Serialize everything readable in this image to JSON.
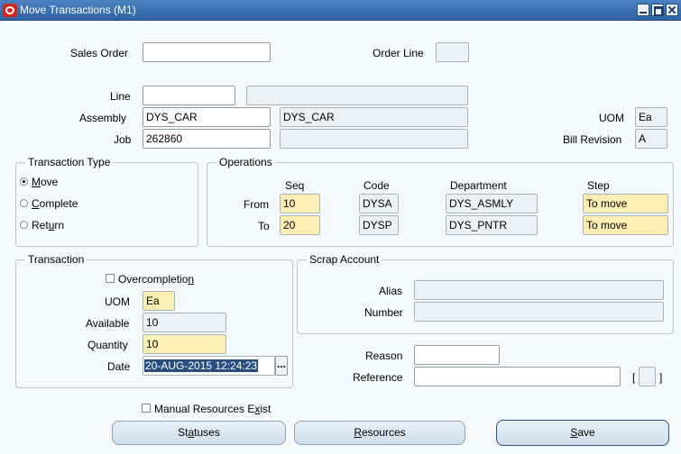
{
  "window": {
    "title": "Move Transactions (M1)"
  },
  "header": {
    "sales_order_label": "Sales Order",
    "sales_order_value": "",
    "order_line_label": "Order Line",
    "order_line_value": "",
    "line_label": "Line",
    "line_value": "",
    "line_desc": "",
    "assembly_label": "Assembly",
    "assembly_value": "DYS_CAR",
    "assembly_desc": "DYS_CAR",
    "job_label": "Job",
    "job_value": "262860",
    "job_desc": "",
    "uom_label": "UOM",
    "uom_value": "Ea",
    "bill_revision_label": "Bill Revision",
    "bill_revision_value": "A"
  },
  "transaction_type": {
    "title": "Transaction Type",
    "options": [
      {
        "pre": "",
        "mn": "M",
        "post": "ove",
        "selected": true
      },
      {
        "pre": "",
        "mn": "C",
        "post": "omplete",
        "selected": false
      },
      {
        "pre": "Ret",
        "mn": "u",
        "post": "rn",
        "selected": false
      }
    ]
  },
  "operations": {
    "title": "Operations",
    "headers": {
      "seq": "Seq",
      "code": "Code",
      "department": "Department",
      "step": "Step"
    },
    "from": {
      "label": "From",
      "seq": "10",
      "code": "DYSA",
      "department": "DYS_ASMLY",
      "step": "To move"
    },
    "to": {
      "label": "To",
      "seq": "20",
      "code": "DYSP",
      "department": "DYS_PNTR",
      "step": "To move"
    }
  },
  "transaction": {
    "title": "Transaction",
    "overcompletion_pre": "Overcompletio",
    "overcompletion_mn": "n",
    "uom_label": "UOM",
    "uom_value": "Ea",
    "available_label": "Available",
    "available_value": "10",
    "quantity_label": "Quantity",
    "quantity_value": "10",
    "date_label": "Date",
    "date_value": "20-AUG-2015 12:24:23",
    "lov_glyph": "..."
  },
  "scrap": {
    "title": "Scrap Account",
    "alias_label": "Alias",
    "alias_value": "",
    "number_label": "Number",
    "number_value": ""
  },
  "reason": {
    "label": "Reason",
    "value": ""
  },
  "reference": {
    "label": "Reference",
    "value": ""
  },
  "flex_field": {
    "open": "[",
    "close": "]"
  },
  "manual_resources": {
    "pre": "Manual Resources E",
    "mn": "x",
    "post": "ist"
  },
  "buttons": {
    "statuses": {
      "pre": "St",
      "mn": "a",
      "post": "tuses"
    },
    "resources": {
      "pre": "",
      "mn": "R",
      "post": "esources"
    },
    "save": {
      "pre": "",
      "mn": "S",
      "post": "ave"
    }
  }
}
